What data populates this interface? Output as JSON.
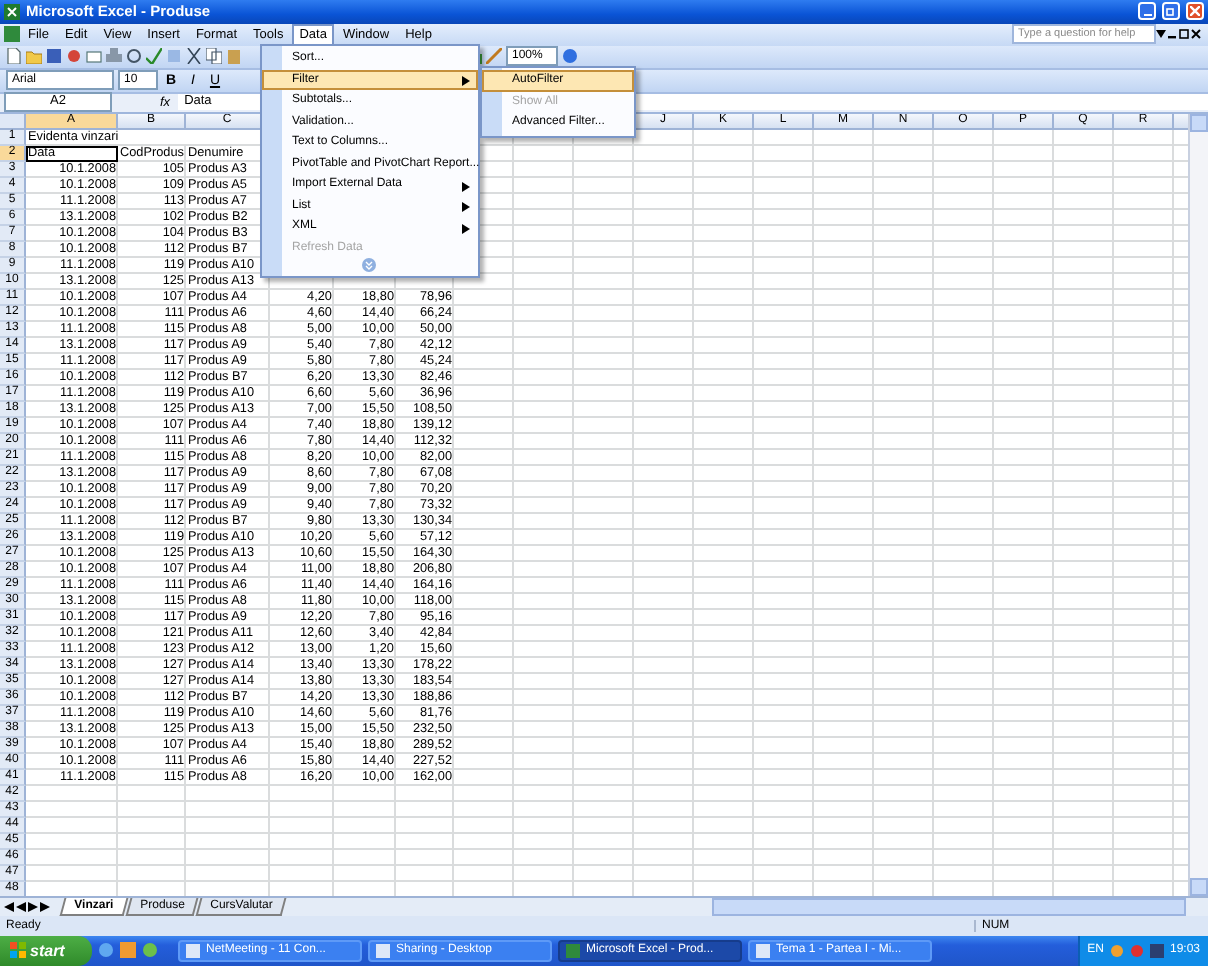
{
  "window": {
    "title": "Microsoft Excel - Produse"
  },
  "menu_bar": {
    "items": [
      {
        "label": "File",
        "selected": false
      },
      {
        "label": "Edit",
        "selected": false
      },
      {
        "label": "View",
        "selected": false
      },
      {
        "label": "Insert",
        "selected": false
      },
      {
        "label": "Format",
        "selected": false
      },
      {
        "label": "Tools",
        "selected": false
      },
      {
        "label": "Data",
        "selected": true
      },
      {
        "label": "Window",
        "selected": false
      },
      {
        "label": "Help",
        "selected": false
      }
    ],
    "help_placeholder": "Type a question for help"
  },
  "toolbar": {
    "zoom": "100%",
    "font": "Arial",
    "font_size": "10",
    "bold": "B",
    "italic": "I",
    "underline": "U"
  },
  "formula_bar": {
    "name_box": "A2",
    "fx": "fx",
    "content": "Data"
  },
  "columns_left": [
    {
      "header": "A",
      "selected": true
    },
    {
      "header": "B",
      "selected": false
    },
    {
      "header": "C",
      "selected": false
    }
  ],
  "columns_right": [
    {
      "header": "J",
      "selected": false
    },
    {
      "header": "K",
      "selected": false
    },
    {
      "header": "L",
      "selected": false
    },
    {
      "header": "M",
      "selected": false
    },
    {
      "header": "N",
      "selected": false
    },
    {
      "header": "O",
      "selected": false
    },
    {
      "header": "P",
      "selected": false
    },
    {
      "header": "Q",
      "selected": false
    },
    {
      "header": "R",
      "selected": false
    }
  ],
  "rows": [
    {
      "number": "1",
      "kind": "title",
      "active": false,
      "cells": [
        "Evidenta vinzari"
      ]
    },
    {
      "number": "2",
      "kind": "header",
      "active": true,
      "cells": [
        "Data",
        "CodProdus",
        "Denumire"
      ]
    },
    {
      "number": "3",
      "kind": "data",
      "active": false,
      "cells": [
        "10.1.2008",
        "105",
        "Produs A3"
      ]
    },
    {
      "number": "4",
      "kind": "data",
      "active": false,
      "cells": [
        "10.1.2008",
        "109",
        "Produs A5"
      ]
    },
    {
      "number": "5",
      "kind": "data",
      "active": false,
      "cells": [
        "11.1.2008",
        "113",
        "Produs A7"
      ]
    },
    {
      "number": "6",
      "kind": "data",
      "active": false,
      "cells": [
        "13.1.2008",
        "102",
        "Produs B2"
      ]
    },
    {
      "number": "7",
      "kind": "data",
      "active": false,
      "cells": [
        "10.1.2008",
        "104",
        "Produs B3"
      ]
    },
    {
      "number": "8",
      "kind": "data",
      "active": false,
      "cells": [
        "10.1.2008",
        "112",
        "Produs B7"
      ]
    },
    {
      "number": "9",
      "kind": "data",
      "active": false,
      "cells": [
        "11.1.2008",
        "119",
        "Produs A10"
      ]
    },
    {
      "number": "10",
      "kind": "data",
      "active": false,
      "cells": [
        "13.1.2008",
        "125",
        "Produs A13"
      ]
    },
    {
      "number": "11",
      "kind": "data",
      "active": false,
      "cells": [
        "10.1.2008",
        "107",
        "Produs A4",
        "4,20",
        "18,80",
        "78,96"
      ]
    },
    {
      "number": "12",
      "kind": "data",
      "active": false,
      "cells": [
        "10.1.2008",
        "111",
        "Produs A6",
        "4,60",
        "14,40",
        "66,24"
      ]
    },
    {
      "number": "13",
      "kind": "data",
      "active": false,
      "cells": [
        "11.1.2008",
        "115",
        "Produs A8",
        "5,00",
        "10,00",
        "50,00"
      ]
    },
    {
      "number": "14",
      "kind": "data",
      "active": false,
      "cells": [
        "13.1.2008",
        "117",
        "Produs A9",
        "5,40",
        "7,80",
        "42,12"
      ]
    },
    {
      "number": "15",
      "kind": "data",
      "active": false,
      "cells": [
        "11.1.2008",
        "117",
        "Produs A9",
        "5,80",
        "7,80",
        "45,24"
      ]
    },
    {
      "number": "16",
      "kind": "data",
      "active": false,
      "cells": [
        "10.1.2008",
        "112",
        "Produs B7",
        "6,20",
        "13,30",
        "82,46"
      ]
    },
    {
      "number": "17",
      "kind": "data",
      "active": false,
      "cells": [
        "11.1.2008",
        "119",
        "Produs A10",
        "6,60",
        "5,60",
        "36,96"
      ]
    },
    {
      "number": "18",
      "kind": "data",
      "active": false,
      "cells": [
        "13.1.2008",
        "125",
        "Produs A13",
        "7,00",
        "15,50",
        "108,50"
      ]
    },
    {
      "number": "19",
      "kind": "data",
      "active": false,
      "cells": [
        "10.1.2008",
        "107",
        "Produs A4",
        "7,40",
        "18,80",
        "139,12"
      ]
    },
    {
      "number": "20",
      "kind": "data",
      "active": false,
      "cells": [
        "10.1.2008",
        "111",
        "Produs A6",
        "7,80",
        "14,40",
        "112,32"
      ]
    },
    {
      "number": "21",
      "kind": "data",
      "active": false,
      "cells": [
        "11.1.2008",
        "115",
        "Produs A8",
        "8,20",
        "10,00",
        "82,00"
      ]
    },
    {
      "number": "22",
      "kind": "data",
      "active": false,
      "cells": [
        "13.1.2008",
        "117",
        "Produs A9",
        "8,60",
        "7,80",
        "67,08"
      ]
    },
    {
      "number": "23",
      "kind": "data",
      "active": false,
      "cells": [
        "10.1.2008",
        "117",
        "Produs A9",
        "9,00",
        "7,80",
        "70,20"
      ]
    },
    {
      "number": "24",
      "kind": "data",
      "active": false,
      "cells": [
        "10.1.2008",
        "117",
        "Produs A9",
        "9,40",
        "7,80",
        "73,32"
      ]
    },
    {
      "number": "25",
      "kind": "data",
      "active": false,
      "cells": [
        "11.1.2008",
        "112",
        "Produs B7",
        "9,80",
        "13,30",
        "130,34"
      ]
    },
    {
      "number": "26",
      "kind": "data",
      "active": false,
      "cells": [
        "13.1.2008",
        "119",
        "Produs A10",
        "10,20",
        "5,60",
        "57,12"
      ]
    },
    {
      "number": "27",
      "kind": "data",
      "active": false,
      "cells": [
        "10.1.2008",
        "125",
        "Produs A13",
        "10,60",
        "15,50",
        "164,30"
      ]
    },
    {
      "number": "28",
      "kind": "data",
      "active": false,
      "cells": [
        "10.1.2008",
        "107",
        "Produs A4",
        "11,00",
        "18,80",
        "206,80"
      ]
    },
    {
      "number": "29",
      "kind": "data",
      "active": false,
      "cells": [
        "11.1.2008",
        "111",
        "Produs A6",
        "11,40",
        "14,40",
        "164,16"
      ]
    },
    {
      "number": "30",
      "kind": "data",
      "active": false,
      "cells": [
        "13.1.2008",
        "115",
        "Produs A8",
        "11,80",
        "10,00",
        "118,00"
      ]
    },
    {
      "number": "31",
      "kind": "data",
      "active": false,
      "cells": [
        "10.1.2008",
        "117",
        "Produs A9",
        "12,20",
        "7,80",
        "95,16"
      ]
    },
    {
      "number": "32",
      "kind": "data",
      "active": false,
      "cells": [
        "10.1.2008",
        "121",
        "Produs A11",
        "12,60",
        "3,40",
        "42,84"
      ]
    },
    {
      "number": "33",
      "kind": "data",
      "active": false,
      "cells": [
        "11.1.2008",
        "123",
        "Produs A12",
        "13,00",
        "1,20",
        "15,60"
      ]
    },
    {
      "number": "34",
      "kind": "data",
      "active": false,
      "cells": [
        "13.1.2008",
        "127",
        "Produs A14",
        "13,40",
        "13,30",
        "178,22"
      ]
    },
    {
      "number": "35",
      "kind": "data",
      "active": false,
      "cells": [
        "10.1.2008",
        "127",
        "Produs A14",
        "13,80",
        "13,30",
        "183,54"
      ]
    },
    {
      "number": "36",
      "kind": "data",
      "active": false,
      "cells": [
        "10.1.2008",
        "112",
        "Produs B7",
        "14,20",
        "13,30",
        "188,86"
      ]
    },
    {
      "number": "37",
      "kind": "data",
      "active": false,
      "cells": [
        "11.1.2008",
        "119",
        "Produs A10",
        "14,60",
        "5,60",
        "81,76"
      ]
    },
    {
      "number": "38",
      "kind": "data",
      "active": false,
      "cells": [
        "13.1.2008",
        "125",
        "Produs A13",
        "15,00",
        "15,50",
        "232,50"
      ]
    },
    {
      "number": "39",
      "kind": "data",
      "active": false,
      "cells": [
        "10.1.2008",
        "107",
        "Produs A4",
        "15,40",
        "18,80",
        "289,52"
      ]
    },
    {
      "number": "40",
      "kind": "data",
      "active": false,
      "cells": [
        "10.1.2008",
        "111",
        "Produs A6",
        "15,80",
        "14,40",
        "227,52"
      ]
    },
    {
      "number": "41",
      "kind": "data",
      "active": false,
      "cells": [
        "11.1.2008",
        "115",
        "Produs A8",
        "16,20",
        "10,00",
        "162,00"
      ]
    },
    {
      "number": "42",
      "active": false
    },
    {
      "number": "43",
      "active": false
    },
    {
      "number": "44",
      "active": false
    },
    {
      "number": "45",
      "active": false
    },
    {
      "number": "46",
      "active": false
    },
    {
      "number": "47",
      "active": false
    },
    {
      "number": "48",
      "active": false
    }
  ],
  "data_menu": [
    {
      "label": "Sort...",
      "selected": false,
      "disabled": false,
      "submenu": false
    },
    {
      "label": "Filter",
      "selected": true,
      "disabled": false,
      "submenu": true
    },
    {
      "label": "Subtotals...",
      "selected": false,
      "disabled": false,
      "submenu": false
    },
    {
      "label": "Validation...",
      "selected": false,
      "disabled": false,
      "submenu": false
    },
    {
      "label": "Text to Columns...",
      "selected": false,
      "disabled": false,
      "submenu": false
    },
    {
      "label": "PivotTable and PivotChart Report...",
      "selected": false,
      "disabled": false,
      "submenu": false
    },
    {
      "label": "Import External Data",
      "selected": false,
      "disabled": false,
      "submenu": true
    },
    {
      "label": "List",
      "selected": false,
      "disabled": false,
      "submenu": true
    },
    {
      "label": "XML",
      "selected": false,
      "disabled": false,
      "submenu": true
    },
    {
      "label": "Refresh Data",
      "selected": false,
      "disabled": true,
      "submenu": false
    }
  ],
  "filter_submenu": [
    {
      "label": "AutoFilter",
      "selected": true,
      "disabled": false
    },
    {
      "label": "Show All",
      "selected": false,
      "disabled": true
    },
    {
      "label": "Advanced Filter...",
      "selected": false,
      "disabled": false
    }
  ],
  "sheet_tabs": [
    {
      "label": "Vinzari",
      "selected": true
    },
    {
      "label": "Produse",
      "selected": false
    },
    {
      "label": "CursValutar",
      "selected": false
    }
  ],
  "status_bar": {
    "status": "Ready",
    "num": "NUM"
  },
  "taskbar": {
    "start": "start",
    "buttons": [
      {
        "label": "NetMeeting - 11 Con...",
        "selected": false
      },
      {
        "label": "Sharing - Desktop",
        "selected": false
      },
      {
        "label": "Microsoft Excel - Prod...",
        "selected": true
      },
      {
        "label": "Tema 1 - Partea I - Mi...",
        "selected": false
      }
    ],
    "language": "EN",
    "clock": "19:03"
  }
}
